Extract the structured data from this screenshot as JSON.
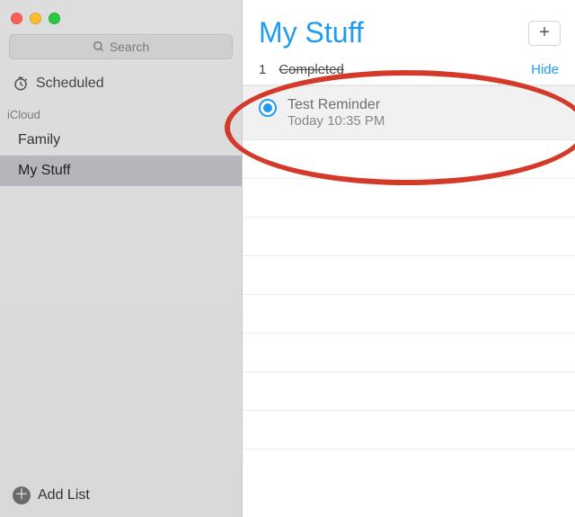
{
  "sidebar": {
    "search_placeholder": "Search",
    "scheduled_label": "Scheduled",
    "section_label": "iCloud",
    "lists": [
      {
        "label": "Family",
        "selected": false
      },
      {
        "label": "My Stuff",
        "selected": true
      }
    ],
    "add_list_label": "Add List"
  },
  "main": {
    "title": "My Stuff",
    "completed": {
      "count": "1",
      "label": "Completed",
      "hide_label": "Hide"
    },
    "reminders": [
      {
        "title": "Test Reminder",
        "subtitle": "Today 10:35 PM",
        "done": true
      }
    ]
  },
  "colors": {
    "accent": "#1f9bf0",
    "annotation": "#d43a2a"
  }
}
